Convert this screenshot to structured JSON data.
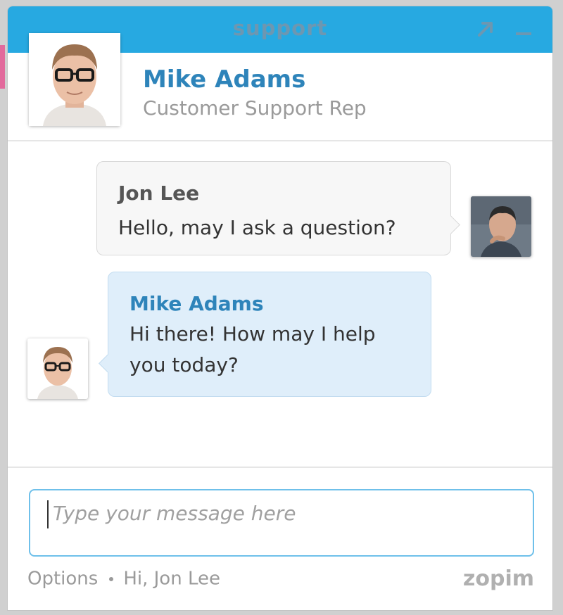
{
  "window": {
    "title": "support",
    "accent_color": "#27a9e1"
  },
  "agent": {
    "name": "Mike Adams",
    "role": "Customer Support Rep"
  },
  "messages": [
    {
      "sender": "Jon Lee",
      "text": "Hello, may I ask a question?",
      "from": "visitor"
    },
    {
      "sender": "Mike Adams",
      "text": "Hi there! How may I help you today?",
      "from": "agent"
    }
  ],
  "composer": {
    "placeholder": "Type your message here"
  },
  "footer": {
    "options_label": "Options",
    "greeting": "Hi, Jon Lee",
    "brand": "zopim"
  },
  "icons": {
    "popout": "popout-arrow-icon",
    "minimize": "minimize-icon"
  }
}
